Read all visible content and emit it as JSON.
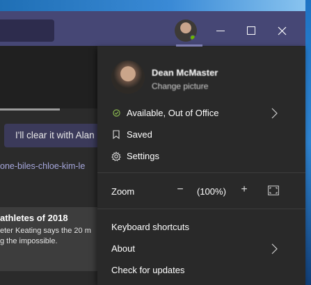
{
  "background": {
    "reply_button": "I'll clear it with Alan",
    "link_text": "one-biles-chloe-kim-le",
    "card": {
      "title": "athletes of 2018",
      "line1": "eter Keating says the 20 m",
      "line2": "g the impossible."
    }
  },
  "profile": {
    "name": "Dean McMaster",
    "subtitle": "Change picture"
  },
  "menu": {
    "status": "Available, Out of Office",
    "saved": "Saved",
    "settings": "Settings",
    "zoom_label": "Zoom",
    "zoom_minus": "−",
    "zoom_value": "(100%)",
    "zoom_plus": "+",
    "keyboard_shortcuts": "Keyboard shortcuts",
    "about": "About",
    "check_updates": "Check for updates"
  },
  "colors": {
    "titlebar": "#464775",
    "status_available": "#92c353",
    "menu_bg": "#292929"
  }
}
